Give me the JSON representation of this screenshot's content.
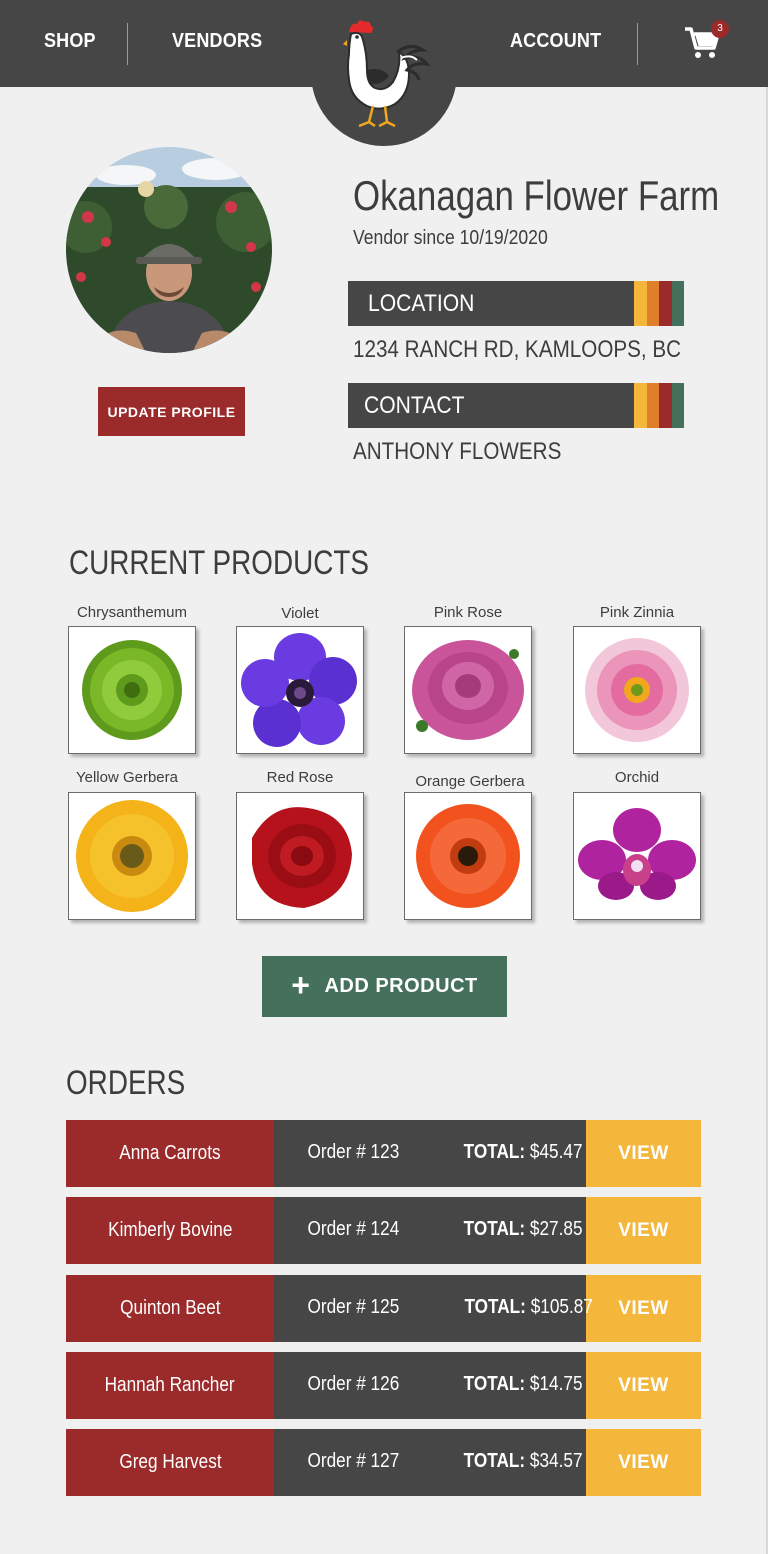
{
  "nav": {
    "shop": "SHOP",
    "vendors": "VENDORS",
    "account": "ACCOUNT",
    "cart_count": "3",
    "logo_icon": "rooster-logo-icon",
    "cart_icon": "cart-icon"
  },
  "profile": {
    "farm_name": "Okanagan Flower Farm",
    "vendor_since": "Vendor since 10/19/2020",
    "update_button": "UPDATE PROFILE",
    "location_label": "LOCATION",
    "location_value": "1234 RANCH RD, KAMLOOPS, BC",
    "contact_label": "CONTACT",
    "contact_value": "ANTHONY FLOWERS",
    "stripe_colors": [
      "#f4b73c",
      "#e07f2a",
      "#9b2a2b",
      "#45705c"
    ]
  },
  "products": {
    "title": "CURRENT PRODUCTS",
    "items": [
      {
        "name": "Chrysanthemum",
        "color": "#7ab828"
      },
      {
        "name": "Violet",
        "color": "#6a3be0"
      },
      {
        "name": "Pink Rose",
        "color": "#c9549a"
      },
      {
        "name": "Pink Zinnia",
        "color": "#e46b9f"
      },
      {
        "name": "Yellow Gerbera",
        "color": "#f3b319"
      },
      {
        "name": "Red Rose",
        "color": "#b5121b"
      },
      {
        "name": "Orange Gerbera",
        "color": "#f2531e"
      },
      {
        "name": "Orchid",
        "color": "#b0239e"
      }
    ],
    "add_button": "ADD PRODUCT"
  },
  "orders": {
    "title": "ORDERS",
    "total_label": "TOTAL:",
    "view_label": "VIEW",
    "rows": [
      {
        "customer": "Anna Carrots",
        "order": "Order # 123",
        "total": "$45.47"
      },
      {
        "customer": "Kimberly Bovine",
        "order": "Order # 124",
        "total": "$27.85"
      },
      {
        "customer": "Quinton Beet",
        "order": "Order # 125",
        "total": "$105.87"
      },
      {
        "customer": "Hannah Rancher",
        "order": "Order # 126",
        "total": "$14.75"
      },
      {
        "customer": "Greg Harvest",
        "order": "Order # 127",
        "total": "$34.57"
      }
    ]
  }
}
